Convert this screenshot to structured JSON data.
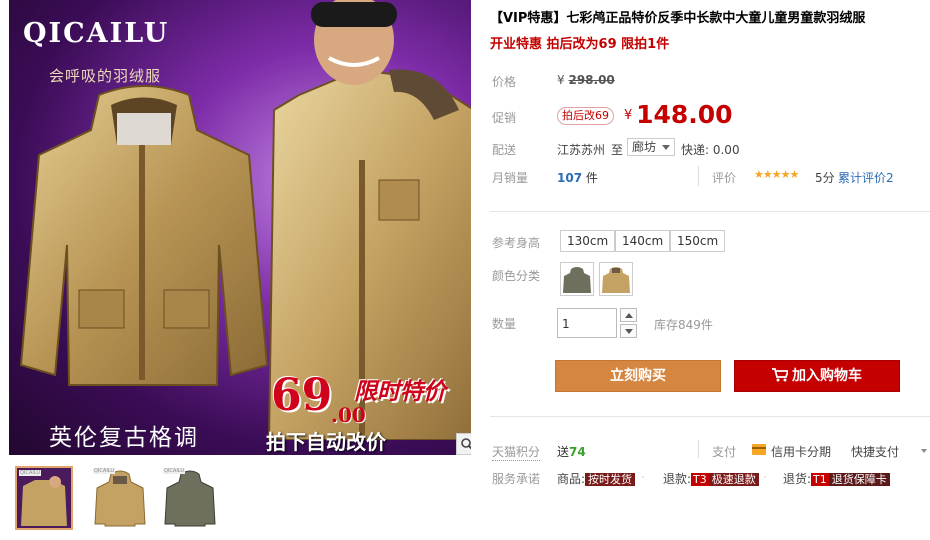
{
  "gallery": {
    "brand": "QICAILU",
    "slogan": "会呼吸的羽绒服",
    "price_big": "69",
    "price_dec": ".00",
    "promo": "限时特价",
    "auto_change": "拍下自动改价",
    "style_text": "英伦复古格调",
    "zoom_icon": "magnifier-icon",
    "thumbs": [
      {
        "tag": "QICAILU"
      },
      {
        "tag": "QICAILU"
      },
      {
        "tag": "QICAILU"
      }
    ]
  },
  "product": {
    "title": "【VIP特惠】七彩鸬正品特价反季中长款中大童儿童男童款羽绒服",
    "subtitle": "开业特惠 拍后改为69 限拍1件"
  },
  "price": {
    "label": "价格",
    "currency": "¥",
    "original": "298.00",
    "promo_label": "促销",
    "badge": "拍后改69",
    "current": "148.00"
  },
  "shipping": {
    "label": "配送",
    "from": "江苏苏州",
    "to_word": "至",
    "dest": "廊坊",
    "fee": "快递: 0.00"
  },
  "sales": {
    "label": "月销量",
    "count": "107",
    "unit": "件",
    "rating_label": "评价",
    "stars": "★★★★★",
    "score": "5分",
    "review_link": "累计评价2"
  },
  "options": {
    "size_label": "参考身高",
    "sizes": [
      "130cm",
      "140cm",
      "150cm"
    ],
    "color_label": "颜色分类",
    "qty_label": "数量",
    "qty_value": "1",
    "stock": "库存849件"
  },
  "buttons": {
    "buy": "立刻购买",
    "cart": "加入购物车"
  },
  "extras": {
    "points_label": "天猫积分",
    "points_prefix": "送",
    "points_value": "74",
    "pay_label": "支付",
    "credit": "信用卡分期",
    "quickpay": "快捷支付",
    "service_label": "服务承诺",
    "svc_goods_prefix": "商品:",
    "svc_goods_tag": "按时发货",
    "svc_refund_prefix": "退款:",
    "svc_refund_code": "T3",
    "svc_refund_tag": "极速退款",
    "svc_return_prefix": "退货:",
    "svc_return_code": "T1",
    "svc_return_tag": "退货保障卡"
  },
  "colors": {
    "accent_red": "#c40000",
    "buy_orange": "#d58742",
    "link_blue": "#2c6bb6",
    "points_green": "#3aa02c"
  }
}
